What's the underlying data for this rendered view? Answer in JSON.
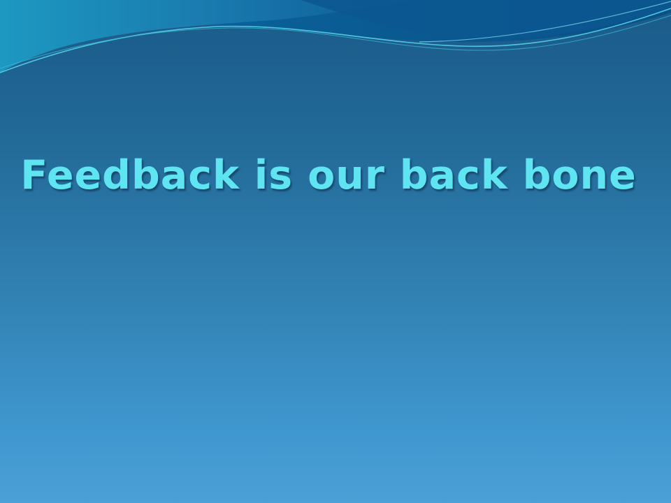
{
  "slide": {
    "title": "Feedback is our back bone"
  },
  "theme": {
    "background_top": "#1a5a89",
    "background_bottom": "#4ba0d6",
    "title_color": "#5fe4f1",
    "wave_colors": [
      "#0a4f86",
      "#1fa3c5",
      "#46d0e8"
    ]
  }
}
